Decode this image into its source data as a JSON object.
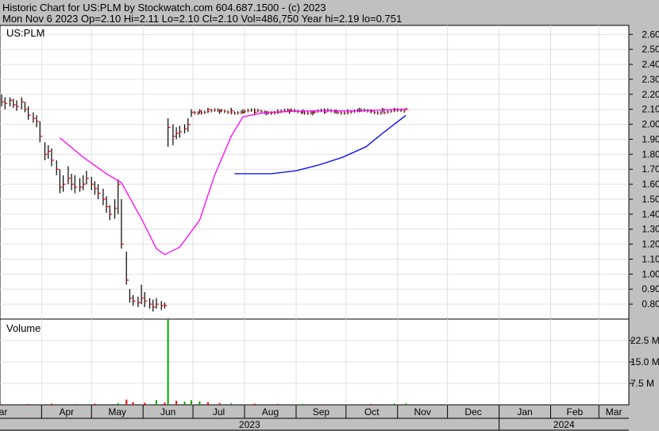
{
  "header": {
    "line1": "Historic Chart for US:PLM by Stockwatch.com 604.687.1500 - (c) 2023",
    "line2": "Mon Nov  6 2023  Op=2.10  Hi=2.11  Lo=2.10  Cl=2.10  Vol=486,750  Year hi=2.19  lo=0.751"
  },
  "colors": {
    "background": "#c0c0c0",
    "panel": "#ffffff",
    "price_bar": "#000000",
    "close_tick": "#ff0000",
    "ma_short": "#ff00ff",
    "ma_long": "#0000ff",
    "volume_up": "#00aa00",
    "volume_down": "#ff0000"
  },
  "chart_data": [
    {
      "type": "line",
      "panel_label": "US:PLM",
      "y_ticks": [
        "2.60",
        "2.50",
        "2.40",
        "2.30",
        "2.20",
        "2.10",
        "2.00",
        "1.90",
        "1.80",
        "1.70",
        "1.60",
        "1.50",
        "1.40",
        "1.30",
        "1.20",
        "1.10",
        "1.00",
        "0.90",
        "0.80"
      ],
      "ylim": [
        0.7,
        2.66
      ],
      "x_tick_labels": [
        "ar",
        "Apr",
        "May",
        "Jun",
        "Jul",
        "Aug",
        "Sep",
        "Oct",
        "Nov",
        "Dec",
        "Jan",
        "Feb",
        "Mar"
      ],
      "year_labels": [
        "2023",
        "2024"
      ],
      "x_start": "2023-03-07",
      "x_end": "2024-03-19",
      "grid": true,
      "price_bars": [
        {
          "date": "2023-03-08",
          "high": 2.2,
          "low": 2.12,
          "close": 2.15
        },
        {
          "date": "2023-03-10",
          "high": 2.18,
          "low": 2.1,
          "close": 2.14
        },
        {
          "date": "2023-03-13",
          "high": 2.18,
          "low": 2.12,
          "close": 2.16
        },
        {
          "date": "2023-03-15",
          "high": 2.17,
          "low": 2.11,
          "close": 2.13
        },
        {
          "date": "2023-03-17",
          "high": 2.16,
          "low": 2.09,
          "close": 2.12
        },
        {
          "date": "2023-03-20",
          "high": 2.18,
          "low": 2.1,
          "close": 2.15
        },
        {
          "date": "2023-03-22",
          "high": 2.15,
          "low": 2.08,
          "close": 2.1
        },
        {
          "date": "2023-03-24",
          "high": 2.12,
          "low": 2.03,
          "close": 2.06
        },
        {
          "date": "2023-03-27",
          "high": 2.08,
          "low": 2.01,
          "close": 2.04
        },
        {
          "date": "2023-03-29",
          "high": 2.06,
          "low": 1.98,
          "close": 2.02
        },
        {
          "date": "2023-03-31",
          "high": 2.02,
          "low": 1.88,
          "close": 1.92
        },
        {
          "date": "2023-04-03",
          "high": 1.88,
          "low": 1.76,
          "close": 1.8
        },
        {
          "date": "2023-04-05",
          "high": 1.86,
          "low": 1.77,
          "close": 1.82
        },
        {
          "date": "2023-04-07",
          "high": 1.84,
          "low": 1.72,
          "close": 1.76
        },
        {
          "date": "2023-04-10",
          "high": 1.76,
          "low": 1.66,
          "close": 1.7
        },
        {
          "date": "2023-04-12",
          "high": 1.7,
          "low": 1.54,
          "close": 1.58
        },
        {
          "date": "2023-04-14",
          "high": 1.66,
          "low": 1.55,
          "close": 1.6
        },
        {
          "date": "2023-04-17",
          "high": 1.72,
          "low": 1.6,
          "close": 1.64
        },
        {
          "date": "2023-04-19",
          "high": 1.67,
          "low": 1.56,
          "close": 1.6
        },
        {
          "date": "2023-04-21",
          "high": 1.66,
          "low": 1.54,
          "close": 1.58
        },
        {
          "date": "2023-04-24",
          "high": 1.64,
          "low": 1.55,
          "close": 1.58
        },
        {
          "date": "2023-04-26",
          "high": 1.66,
          "low": 1.56,
          "close": 1.6
        },
        {
          "date": "2023-04-28",
          "high": 1.69,
          "low": 1.6,
          "close": 1.64
        },
        {
          "date": "2023-05-01",
          "high": 1.65,
          "low": 1.56,
          "close": 1.6
        },
        {
          "date": "2023-05-03",
          "high": 1.62,
          "low": 1.53,
          "close": 1.57
        },
        {
          "date": "2023-05-05",
          "high": 1.6,
          "low": 1.5,
          "close": 1.54
        },
        {
          "date": "2023-05-08",
          "high": 1.57,
          "low": 1.46,
          "close": 1.5
        },
        {
          "date": "2023-05-10",
          "high": 1.52,
          "low": 1.41,
          "close": 1.45
        },
        {
          "date": "2023-05-12",
          "high": 1.46,
          "low": 1.36,
          "close": 1.4
        },
        {
          "date": "2023-05-15",
          "high": 1.5,
          "low": 1.37,
          "close": 1.44
        },
        {
          "date": "2023-05-17",
          "high": 1.63,
          "low": 1.4,
          "close": 1.6
        },
        {
          "date": "2023-05-19",
          "high": 1.5,
          "low": 1.17,
          "close": 1.2
        },
        {
          "date": "2023-05-22",
          "high": 1.15,
          "low": 0.93,
          "close": 0.96
        },
        {
          "date": "2023-05-24",
          "high": 0.9,
          "low": 0.81,
          "close": 0.84
        },
        {
          "date": "2023-05-26",
          "high": 0.86,
          "low": 0.79,
          "close": 0.82
        },
        {
          "date": "2023-05-29",
          "high": 0.85,
          "low": 0.78,
          "close": 0.81
        },
        {
          "date": "2023-05-31",
          "high": 0.93,
          "low": 0.8,
          "close": 0.84
        },
        {
          "date": "2023-06-02",
          "high": 0.88,
          "low": 0.78,
          "close": 0.82
        },
        {
          "date": "2023-06-05",
          "high": 0.84,
          "low": 0.77,
          "close": 0.8
        },
        {
          "date": "2023-06-07",
          "high": 0.83,
          "low": 0.75,
          "close": 0.78
        },
        {
          "date": "2023-06-09",
          "high": 0.84,
          "low": 0.77,
          "close": 0.8
        },
        {
          "date": "2023-06-12",
          "high": 0.82,
          "low": 0.76,
          "close": 0.79
        },
        {
          "date": "2023-06-14",
          "high": 0.81,
          "low": 0.77,
          "close": 0.79
        },
        {
          "date": "2023-06-16",
          "high": 2.04,
          "low": 1.85,
          "close": 1.98
        },
        {
          "date": "2023-06-19",
          "high": 2.0,
          "low": 1.86,
          "close": 1.92
        },
        {
          "date": "2023-06-21",
          "high": 1.98,
          "low": 1.9,
          "close": 1.94
        },
        {
          "date": "2023-06-23",
          "high": 1.99,
          "low": 1.91,
          "close": 1.95
        },
        {
          "date": "2023-06-26",
          "high": 2.0,
          "low": 1.94,
          "close": 1.97
        },
        {
          "date": "2023-06-28",
          "high": 2.04,
          "low": 1.95,
          "close": 2.0
        },
        {
          "date": "2023-06-30",
          "high": 2.1,
          "low": 2.05,
          "close": 2.08
        },
        {
          "date": "2023-07-05",
          "high": 2.1,
          "low": 2.07,
          "close": 2.09
        },
        {
          "date": "2023-07-10",
          "high": 2.11,
          "low": 2.08,
          "close": 2.1
        },
        {
          "date": "2023-07-17",
          "high": 2.1,
          "low": 2.07,
          "close": 2.09
        },
        {
          "date": "2023-07-24",
          "high": 2.11,
          "low": 2.08,
          "close": 2.09
        },
        {
          "date": "2023-07-31",
          "high": 2.1,
          "low": 2.07,
          "close": 2.08
        },
        {
          "date": "2023-08-07",
          "high": 2.1,
          "low": 2.06,
          "close": 2.08
        },
        {
          "date": "2023-08-14",
          "high": 2.09,
          "low": 2.06,
          "close": 2.08
        },
        {
          "date": "2023-08-21",
          "high": 2.1,
          "low": 2.07,
          "close": 2.08
        },
        {
          "date": "2023-08-28",
          "high": 2.1,
          "low": 2.07,
          "close": 2.09
        },
        {
          "date": "2023-09-05",
          "high": 2.1,
          "low": 2.07,
          "close": 2.09
        },
        {
          "date": "2023-09-11",
          "high": 2.09,
          "low": 2.06,
          "close": 2.08
        },
        {
          "date": "2023-09-18",
          "high": 2.1,
          "low": 2.07,
          "close": 2.08
        },
        {
          "date": "2023-09-25",
          "high": 2.1,
          "low": 2.07,
          "close": 2.09
        },
        {
          "date": "2023-10-02",
          "high": 2.1,
          "low": 2.08,
          "close": 2.09
        },
        {
          "date": "2023-10-09",
          "high": 2.11,
          "low": 2.08,
          "close": 2.09
        },
        {
          "date": "2023-10-16",
          "high": 2.1,
          "low": 2.08,
          "close": 2.09
        },
        {
          "date": "2023-10-23",
          "high": 2.11,
          "low": 2.08,
          "close": 2.1
        },
        {
          "date": "2023-10-30",
          "high": 2.11,
          "low": 2.09,
          "close": 2.1
        },
        {
          "date": "2023-11-06",
          "high": 2.11,
          "low": 2.1,
          "close": 2.1
        }
      ],
      "series": [
        {
          "color": "#ff00ff",
          "points": [
            {
              "date": "2023-04-12",
              "value": 1.91
            },
            {
              "date": "2023-04-26",
              "value": 1.78
            },
            {
              "date": "2023-05-10",
              "value": 1.67
            },
            {
              "date": "2023-05-19",
              "value": 1.61
            },
            {
              "date": "2023-05-31",
              "value": 1.37
            },
            {
              "date": "2023-06-09",
              "value": 1.17
            },
            {
              "date": "2023-06-14",
              "value": 1.13
            },
            {
              "date": "2023-06-23",
              "value": 1.18
            },
            {
              "date": "2023-07-05",
              "value": 1.36
            },
            {
              "date": "2023-07-14",
              "value": 1.66
            },
            {
              "date": "2023-07-24",
              "value": 1.92
            },
            {
              "date": "2023-07-31",
              "value": 2.05
            },
            {
              "date": "2023-08-14",
              "value": 2.08
            },
            {
              "date": "2023-09-11",
              "value": 2.09
            },
            {
              "date": "2023-10-09",
              "value": 2.09
            },
            {
              "date": "2023-11-06",
              "value": 2.1
            }
          ]
        },
        {
          "color": "#0000ff",
          "points": [
            {
              "date": "2023-07-26",
              "value": 1.67
            },
            {
              "date": "2023-08-17",
              "value": 1.67
            },
            {
              "date": "2023-09-01",
              "value": 1.69
            },
            {
              "date": "2023-09-15",
              "value": 1.73
            },
            {
              "date": "2023-09-29",
              "value": 1.78
            },
            {
              "date": "2023-10-13",
              "value": 1.85
            },
            {
              "date": "2023-10-23",
              "value": 1.94
            },
            {
              "date": "2023-11-06",
              "value": 2.06
            }
          ]
        }
      ]
    },
    {
      "type": "bar",
      "panel_label": "Volume",
      "y_ticks": [
        "22.5 M",
        "15.0 M",
        "7.5 M"
      ],
      "ylim": [
        0,
        30
      ],
      "bars": [
        {
          "date": "2023-03-10",
          "value": 0.2,
          "color": "#ff0000"
        },
        {
          "date": "2023-03-24",
          "value": 0.3,
          "color": "#ff0000"
        },
        {
          "date": "2023-04-07",
          "value": 0.4,
          "color": "#ff0000"
        },
        {
          "date": "2023-04-21",
          "value": 0.3,
          "color": "#00aa00"
        },
        {
          "date": "2023-05-03",
          "value": 0.4,
          "color": "#ff0000"
        },
        {
          "date": "2023-05-17",
          "value": 0.6,
          "color": "#00aa00"
        },
        {
          "date": "2023-05-22",
          "value": 1.8,
          "color": "#ff0000"
        },
        {
          "date": "2023-05-26",
          "value": 0.9,
          "color": "#ff0000"
        },
        {
          "date": "2023-06-02",
          "value": 0.7,
          "color": "#ff0000"
        },
        {
          "date": "2023-06-09",
          "value": 1.6,
          "color": "#00aa00"
        },
        {
          "date": "2023-06-14",
          "value": 0.8,
          "color": "#ff0000"
        },
        {
          "date": "2023-06-16",
          "value": 29.8,
          "color": "#00aa00"
        },
        {
          "date": "2023-06-21",
          "value": 1.4,
          "color": "#ff0000"
        },
        {
          "date": "2023-06-26",
          "value": 1.1,
          "color": "#00aa00"
        },
        {
          "date": "2023-06-30",
          "value": 1.6,
          "color": "#00aa00"
        },
        {
          "date": "2023-07-05",
          "value": 1.2,
          "color": "#00aa00"
        },
        {
          "date": "2023-07-10",
          "value": 0.9,
          "color": "#ff0000"
        },
        {
          "date": "2023-07-17",
          "value": 0.6,
          "color": "#ff0000"
        },
        {
          "date": "2023-07-24",
          "value": 0.5,
          "color": "#00aa00"
        },
        {
          "date": "2023-08-07",
          "value": 0.4,
          "color": "#ff0000"
        },
        {
          "date": "2023-08-21",
          "value": 0.3,
          "color": "#ff0000"
        },
        {
          "date": "2023-09-05",
          "value": 0.3,
          "color": "#00aa00"
        },
        {
          "date": "2023-09-18",
          "value": 0.2,
          "color": "#ff0000"
        },
        {
          "date": "2023-10-02",
          "value": 0.2,
          "color": "#00aa00"
        },
        {
          "date": "2023-10-16",
          "value": 0.3,
          "color": "#ff0000"
        },
        {
          "date": "2023-10-30",
          "value": 0.4,
          "color": "#00aa00"
        },
        {
          "date": "2023-11-06",
          "value": 0.5,
          "color": "#00aa00"
        }
      ]
    }
  ]
}
